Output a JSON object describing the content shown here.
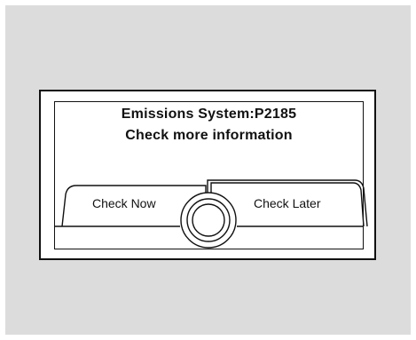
{
  "display": {
    "title_line": "Emissions System:P2185",
    "subtitle_line": "Check more information"
  },
  "buttons": {
    "left_label": "Check Now",
    "right_label": "Check Later",
    "selected": "right"
  },
  "colors": {
    "background": "#dcdcdd",
    "screen": "#ffffff",
    "ink": "#111111"
  },
  "icons": {
    "selector": "rotary-knob"
  }
}
